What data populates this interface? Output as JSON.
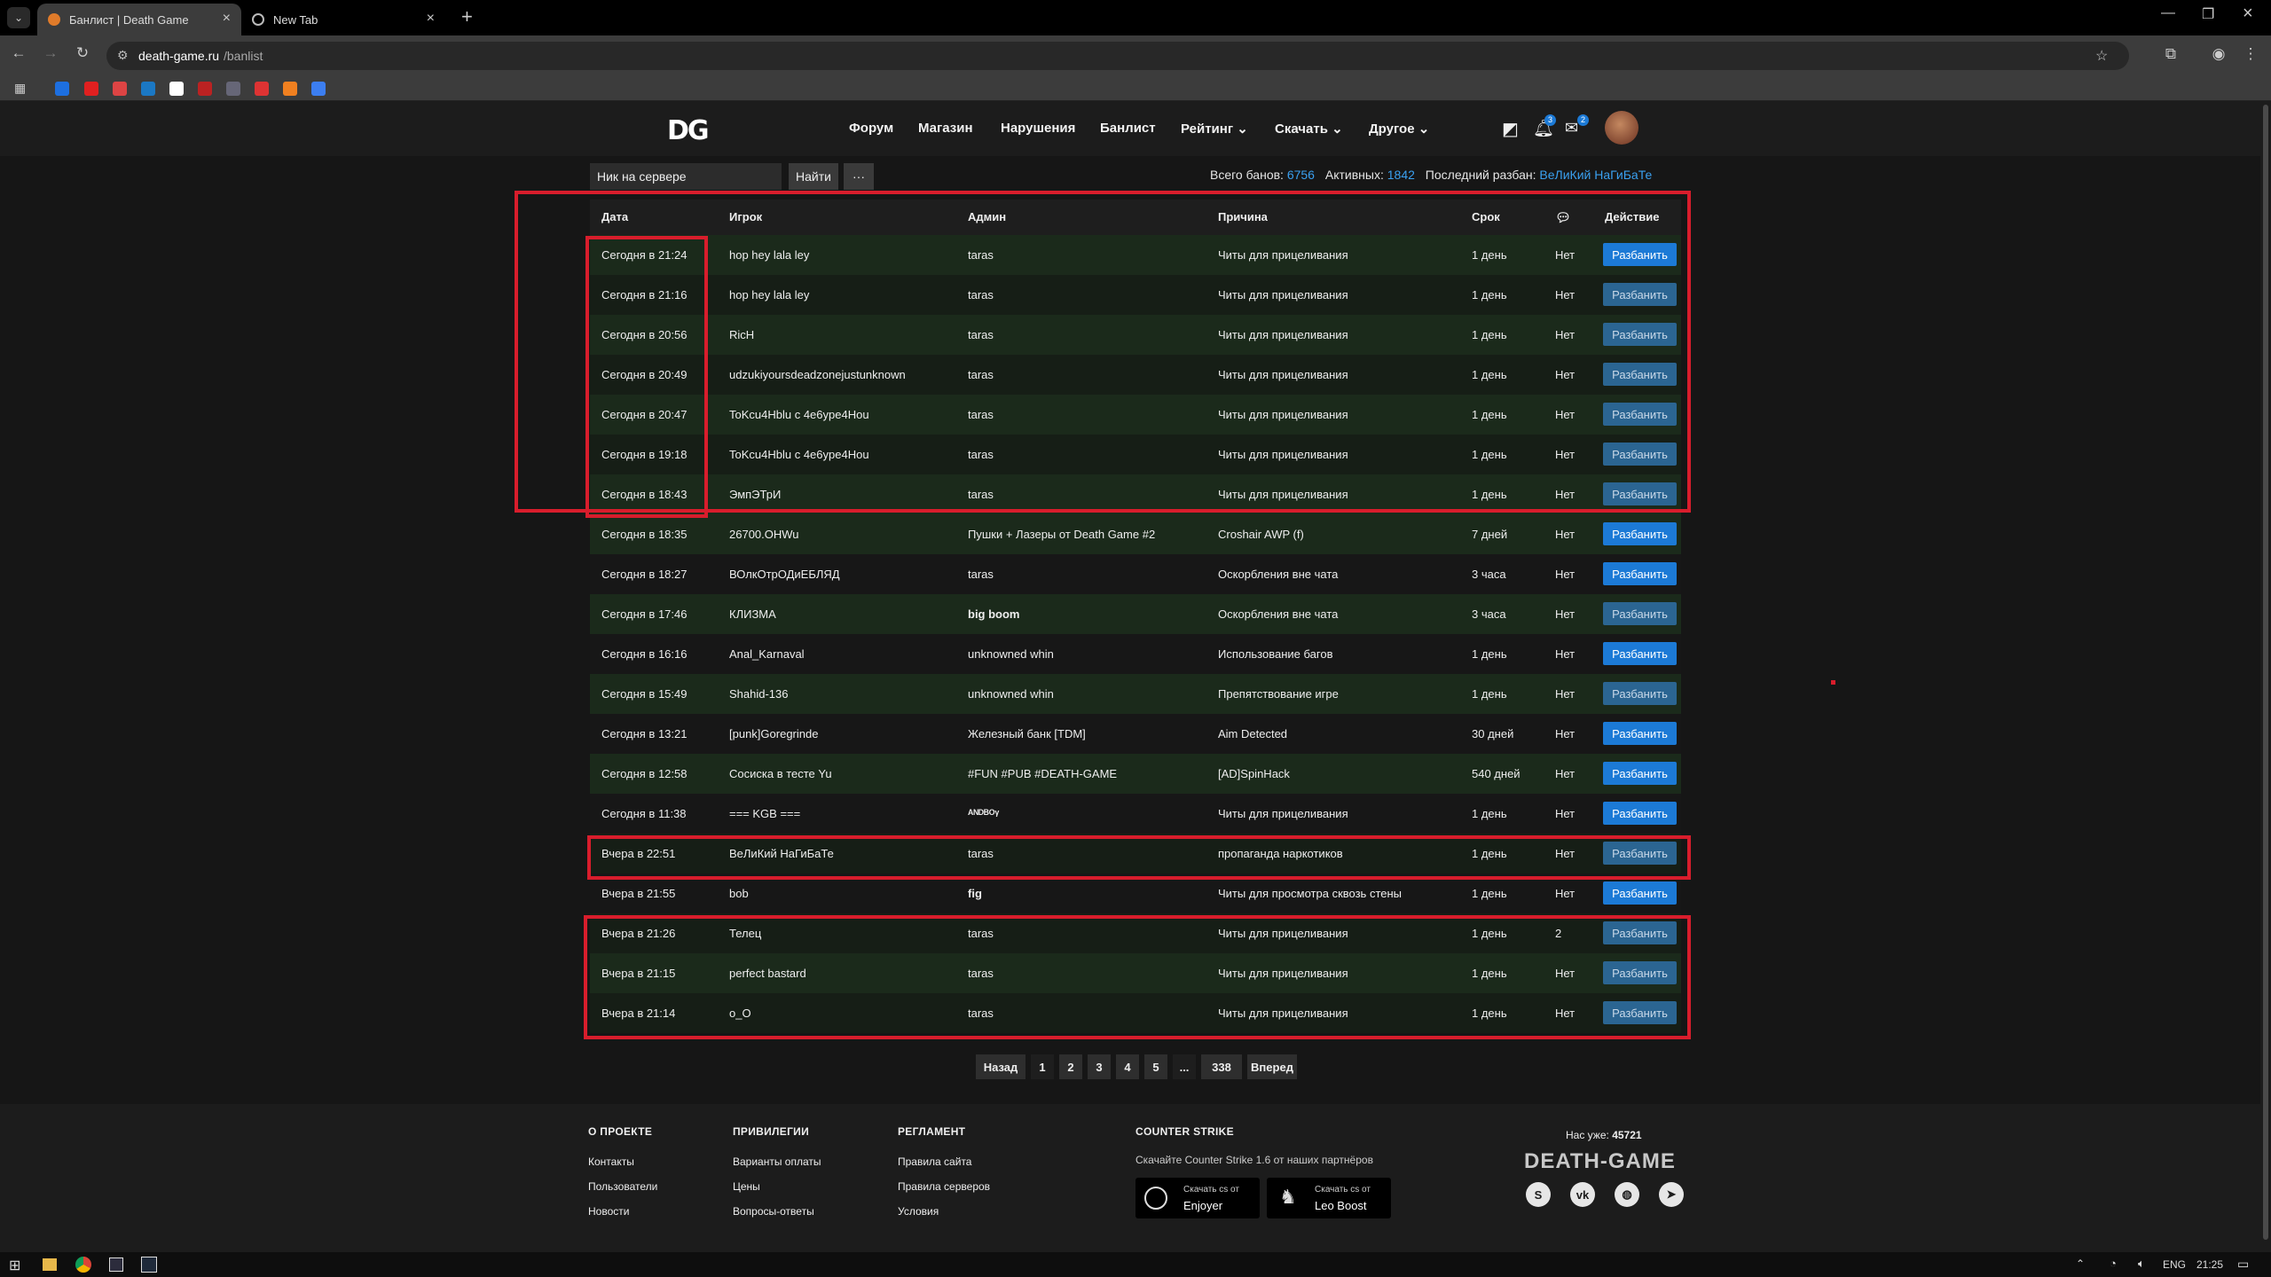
{
  "browser": {
    "tabs": [
      {
        "title": "Банлист | Death Game",
        "active": true
      },
      {
        "title": "New Tab",
        "active": false
      }
    ],
    "url_domain": "death-game.ru",
    "url_path": "/banlist"
  },
  "nav": {
    "logo": "DG",
    "items": [
      "Форум",
      "Магазин",
      "Нарушения",
      "Банлист",
      "Рейтинг",
      "Скачать",
      "Другое"
    ],
    "badges": {
      "bell": "3",
      "mail": "2"
    }
  },
  "search": {
    "placeholder": "Ник на сервере",
    "button": "Найти",
    "more": "···"
  },
  "stats": {
    "total_label": "Всего банов:",
    "total": "6756",
    "active_label": "Активных:",
    "active": "1842",
    "last_label": "Последний разбан:",
    "last": "ВеЛиКий НаГиБаТе"
  },
  "table": {
    "headers": [
      "Дата",
      "Игрок",
      "Админ",
      "Причина",
      "Срок",
      "",
      "Действие"
    ],
    "button_label": "Разбанить",
    "rows": [
      {
        "date": "Сегодня в 21:24",
        "player": "hop hey lala ley",
        "admin": "taras",
        "reason": "Читы для прицеливания",
        "term": "1 день",
        "comm": "Нет"
      },
      {
        "date": "Сегодня в 21:16",
        "player": "hop hey lala ley",
        "admin": "taras",
        "reason": "Читы для прицеливания",
        "term": "1 день",
        "comm": "Нет"
      },
      {
        "date": "Сегодня в 20:56",
        "player": "RicH",
        "admin": "taras",
        "reason": "Читы для прицеливания",
        "term": "1 день",
        "comm": "Нет"
      },
      {
        "date": "Сегодня в 20:49",
        "player": "udzukiyoursdeadzonejustunknown",
        "admin": "taras",
        "reason": "Читы для прицеливания",
        "term": "1 день",
        "comm": "Нет"
      },
      {
        "date": "Сегодня в 20:47",
        "player": "ToKcu4Hblu с 4e6ype4Hou",
        "admin": "taras",
        "reason": "Читы для прицеливания",
        "term": "1 день",
        "comm": "Нет"
      },
      {
        "date": "Сегодня в 19:18",
        "player": "ToKcu4Hblu с 4e6ype4Hou",
        "admin": "taras",
        "reason": "Читы для прицеливания",
        "term": "1 день",
        "comm": "Нет"
      },
      {
        "date": "Сегодня в 18:43",
        "player": "ЭмпЭТрИ",
        "admin": "taras",
        "reason": "Читы для прицеливания",
        "term": "1 день",
        "comm": "Нет"
      },
      {
        "date": "Сегодня в 18:35",
        "player": "26700.OHWu",
        "admin": "Пушки + Лазеры от Death Game #2",
        "reason": "Croshair AWP (f)",
        "term": "7 дней",
        "comm": "Нет"
      },
      {
        "date": "Сегодня в 18:27",
        "player": "ВОлкОтрОДиЕБЛЯД",
        "admin": "taras",
        "reason": "Оскорбления вне чата",
        "term": "3 часа",
        "comm": "Нет"
      },
      {
        "date": "Сегодня в 17:46",
        "player": "КЛИЗМА",
        "admin": "big boom",
        "reason": "Оскорбления вне чата",
        "term": "3 часа",
        "comm": "Нет"
      },
      {
        "date": "Сегодня в 16:16",
        "player": "Anal_Karnaval",
        "admin": "unknowned whin",
        "reason": "Использование багов",
        "term": "1 день",
        "comm": "Нет"
      },
      {
        "date": "Сегодня в 15:49",
        "player": "Shahid-136",
        "admin": "unknowned whin",
        "reason": "Препятствование игре",
        "term": "1 день",
        "comm": "Нет"
      },
      {
        "date": "Сегодня в 13:21",
        "player": "[punk]Goregrinde",
        "admin": "Железный банк [TDM]",
        "reason": "Aim Detected",
        "term": "30 дней",
        "comm": "Нет"
      },
      {
        "date": "Сегодня в 12:58",
        "player": "Сосиска в тесте Yu",
        "admin": "#FUN #PUB #DEATH-GAME",
        "reason": "[AD]SpinHack",
        "term": "540 дней",
        "comm": "Нет"
      },
      {
        "date": "Сегодня в 11:38",
        "player": "=== KGB ===",
        "admin": "ᴬᴺᴰᴮᴼᵞ",
        "reason": "Читы для прицеливания",
        "term": "1 день",
        "comm": "Нет"
      },
      {
        "date": "Вчера в 22:51",
        "player": "ВеЛиКий НаГиБаТе",
        "admin": "taras",
        "reason": "пропаганда наркотиков",
        "term": "1 день",
        "comm": "Нет"
      },
      {
        "date": "Вчера в 21:55",
        "player": "bob",
        "admin": "fig",
        "reason": "Читы для просмотра сквозь стены",
        "term": "1 день",
        "comm": "Нет"
      },
      {
        "date": "Вчера в 21:26",
        "player": "Телец",
        "admin": "taras",
        "reason": "Читы для прицеливания",
        "term": "1 день",
        "comm": "2"
      },
      {
        "date": "Вчера в 21:15",
        "player": "perfect bastard",
        "admin": "taras",
        "reason": "Читы для прицеливания",
        "term": "1 день",
        "comm": "Нет"
      },
      {
        "date": "Вчера в 21:14",
        "player": "o_O",
        "admin": "taras",
        "reason": "Читы для прицеливания",
        "term": "1 день",
        "comm": "Нет"
      }
    ]
  },
  "pagination": {
    "prev": "Назад",
    "pages": [
      "1",
      "2",
      "3",
      "4",
      "5",
      "...",
      "338"
    ],
    "next": "Вперед",
    "current": "1"
  },
  "footer": {
    "about": {
      "title": "О ПРОЕКТЕ",
      "links": [
        "Контакты",
        "Пользователи",
        "Новости"
      ]
    },
    "privileges": {
      "title": "ПРИВИЛЕГИИ",
      "links": [
        "Варианты оплаты",
        "Цены",
        "Вопросы-ответы"
      ]
    },
    "rules": {
      "title": "РЕГЛАМЕНТ",
      "links": [
        "Правила сайта",
        "Правила серверов",
        "Условия"
      ]
    },
    "cs": {
      "title": "COUNTER STRIKE",
      "text": "Скачайте Counter Strike 1.6 от наших партнёров",
      "btn1_small": "Скачать сs от",
      "btn1_name": "Enjoyer",
      "btn2_small": "Скачать сs от",
      "btn2_name": "Leo Boost"
    },
    "count_label": "Нас уже:",
    "count": "45721",
    "brand": "DEATH-GAME",
    "socials": [
      "steam-icon",
      "vk-icon",
      "discord-icon",
      "telegram-icon"
    ]
  },
  "taskbar": {
    "lang": "ENG",
    "time": "21:25"
  },
  "colors": {
    "accent": "#1c7ad6",
    "link": "#3aa0f0",
    "highlight": "#d81d2c"
  }
}
